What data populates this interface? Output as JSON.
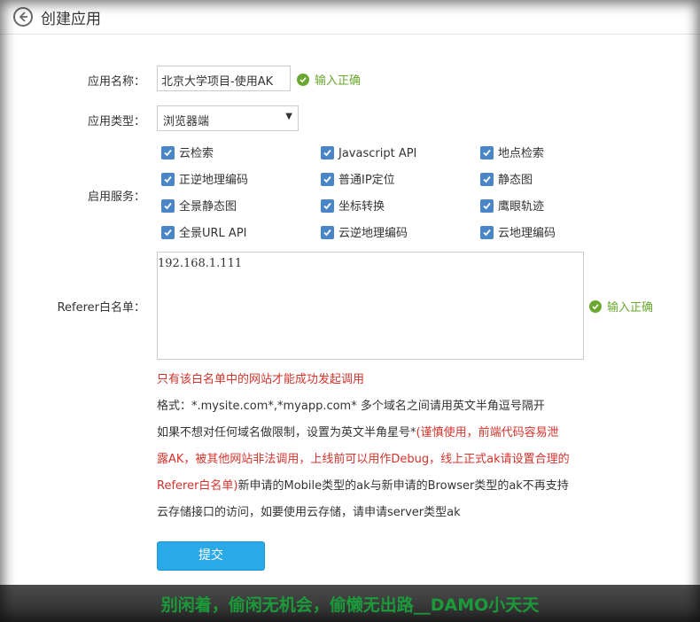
{
  "header": {
    "title": "创建应用"
  },
  "form": {
    "name_label": "应用名称：",
    "name_value": "北京大学项目-使用AK",
    "name_status": "输入正确",
    "type_label": "应用类型：",
    "type_value": "浏览器端",
    "services_label": "启用服务：",
    "services": [
      [
        "云检索",
        "Javascript API",
        "地点检索"
      ],
      [
        "正逆地理编码",
        "普通IP定位",
        "静态图"
      ],
      [
        "全景静态图",
        "坐标转换",
        "鹰眼轨迹"
      ],
      [
        "全景URL API",
        "云逆地理编码",
        "云地理编码"
      ]
    ],
    "referer_label": "Referer白名单：",
    "referer_value": "192.168.1.111",
    "referer_status": "输入正确",
    "hint1": "只有该白名单中的网站才能成功发起调用",
    "hint2": "格式：*.mysite.com*,*myapp.com* 多个域名之间请用英文半角逗号隔开",
    "hint3_a": "如果不想对任何域名做限制，设置为英文半角星号*",
    "hint3_b": "(谨慎使用，前端代码容易泄",
    "hint4": "露AK，被其他网站非法调用，上线前可以用作Debug，线上正式ak请设置合理的",
    "hint5_a": "Referer白名单)",
    "hint5_b": "新申请的Mobile类型的ak与新申请的Browser类型的ak不再支持",
    "hint6": "云存储接口的访问，如要使用云存储，请申请server类型ak",
    "submit_label": "提交"
  },
  "banner": {
    "text": "别闲着，偷闲无机会，偷懒无出路__DAMO小天天"
  }
}
